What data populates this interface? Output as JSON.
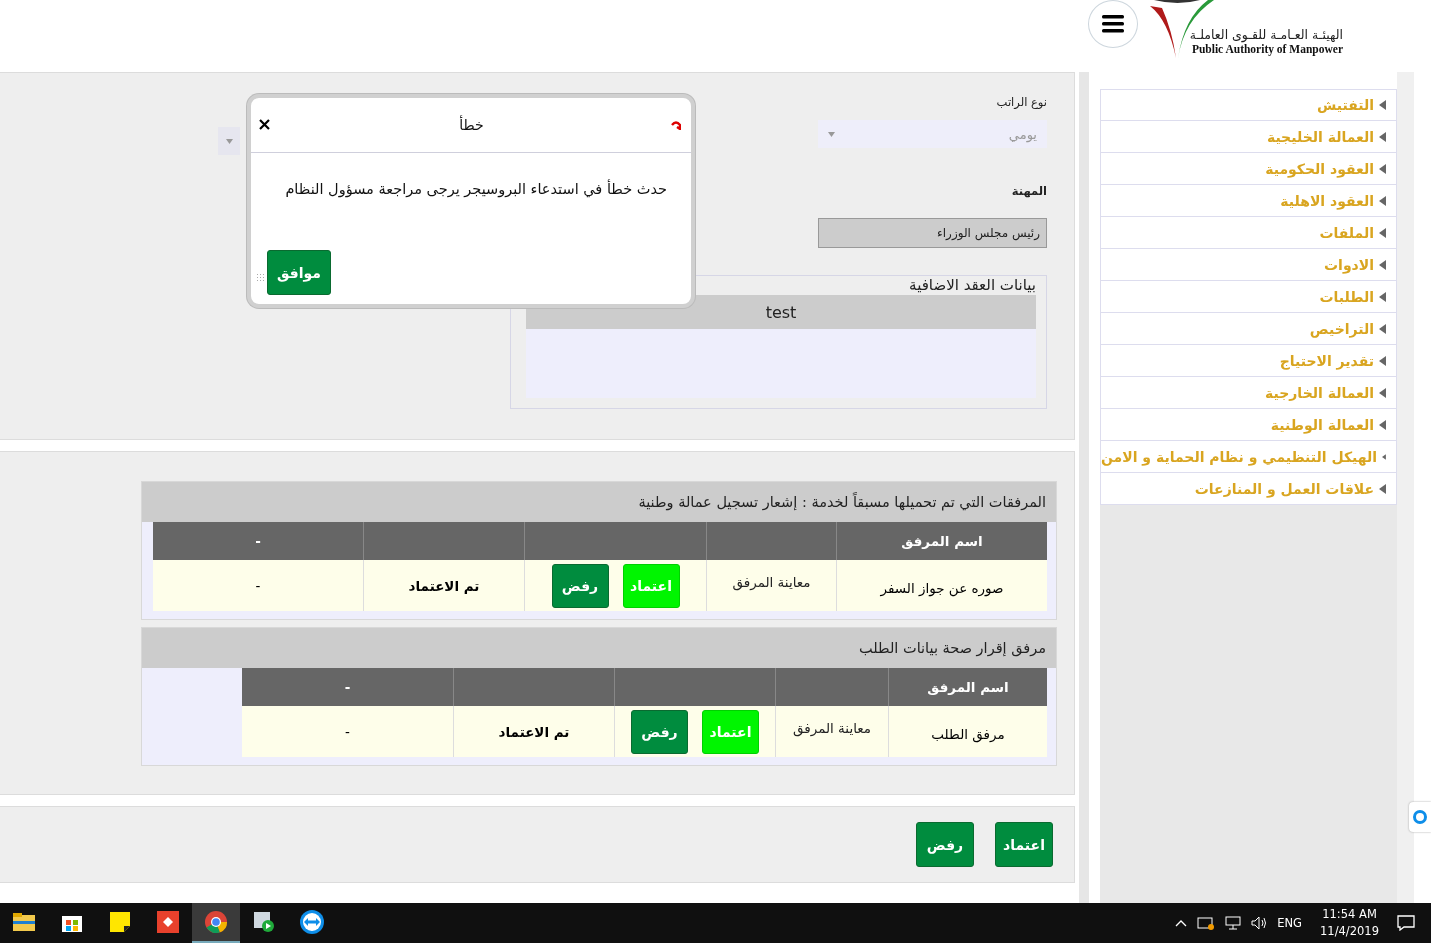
{
  "header": {
    "logo_ar": "الهيئـة العـامـة للقـوى العاملـة",
    "logo_en": "Public Authority of Manpower"
  },
  "form": {
    "salary_type": {
      "label": "نوع الراتب",
      "value": "يومي"
    },
    "occupation": {
      "label": "المهنة",
      "value": "رئيس مجلس الوزراء"
    },
    "extra_contract": {
      "legend": "بيانات العقد الاضافية",
      "columns": [
        "test"
      ]
    }
  },
  "dialog": {
    "title": "خطأ",
    "message": "حدث خطأ في استدعاء البروسيجر يرجى مراجعة مسؤول النظام",
    "button": "موافق"
  },
  "attachment_sections": [
    {
      "title": "المرفقات التي تم تحميلها مسبقاً لخدمة : إشعار تسجيل عمالة وطنية",
      "first_column": "اسم المرفق",
      "last_column": "-",
      "indented": false,
      "rows": [
        {
          "name": "صوره عن جواز السفر",
          "preview": "معاينة المرفق",
          "approve": "اعتماد",
          "reject": "رفض",
          "status": "تم الاعتماد",
          "note": "-"
        }
      ]
    },
    {
      "title": "مرفق إقرار صحة بيانات الطلب",
      "first_column": "اسم المرفق",
      "last_column": "-",
      "indented": true,
      "rows": [
        {
          "name": "مرفق الطلب",
          "preview": "معاينة المرفق",
          "approve": "اعتماد",
          "reject": "رفض",
          "status": "تم الاعتماد",
          "note": "-"
        }
      ]
    }
  ],
  "actions": {
    "approve": "اعتماد",
    "reject": "رفض"
  },
  "sidebar": {
    "items": [
      "التفتيش",
      "العمالة الخليجية",
      "العقود الحكومية",
      "العقود الاهلية",
      "الملفات",
      "الادوات",
      "الطلبات",
      "التراخيص",
      "تقدير الاحتياج",
      "العمالة الخارجية",
      "العمالة الوطنية",
      "الهيكل التنظيمي و نظام الحماية و الامن",
      "علاقات العمل و المنازعات"
    ]
  },
  "taskbar": {
    "language": "ENG",
    "time": "11:54 AM",
    "date": "11/4/2019"
  }
}
